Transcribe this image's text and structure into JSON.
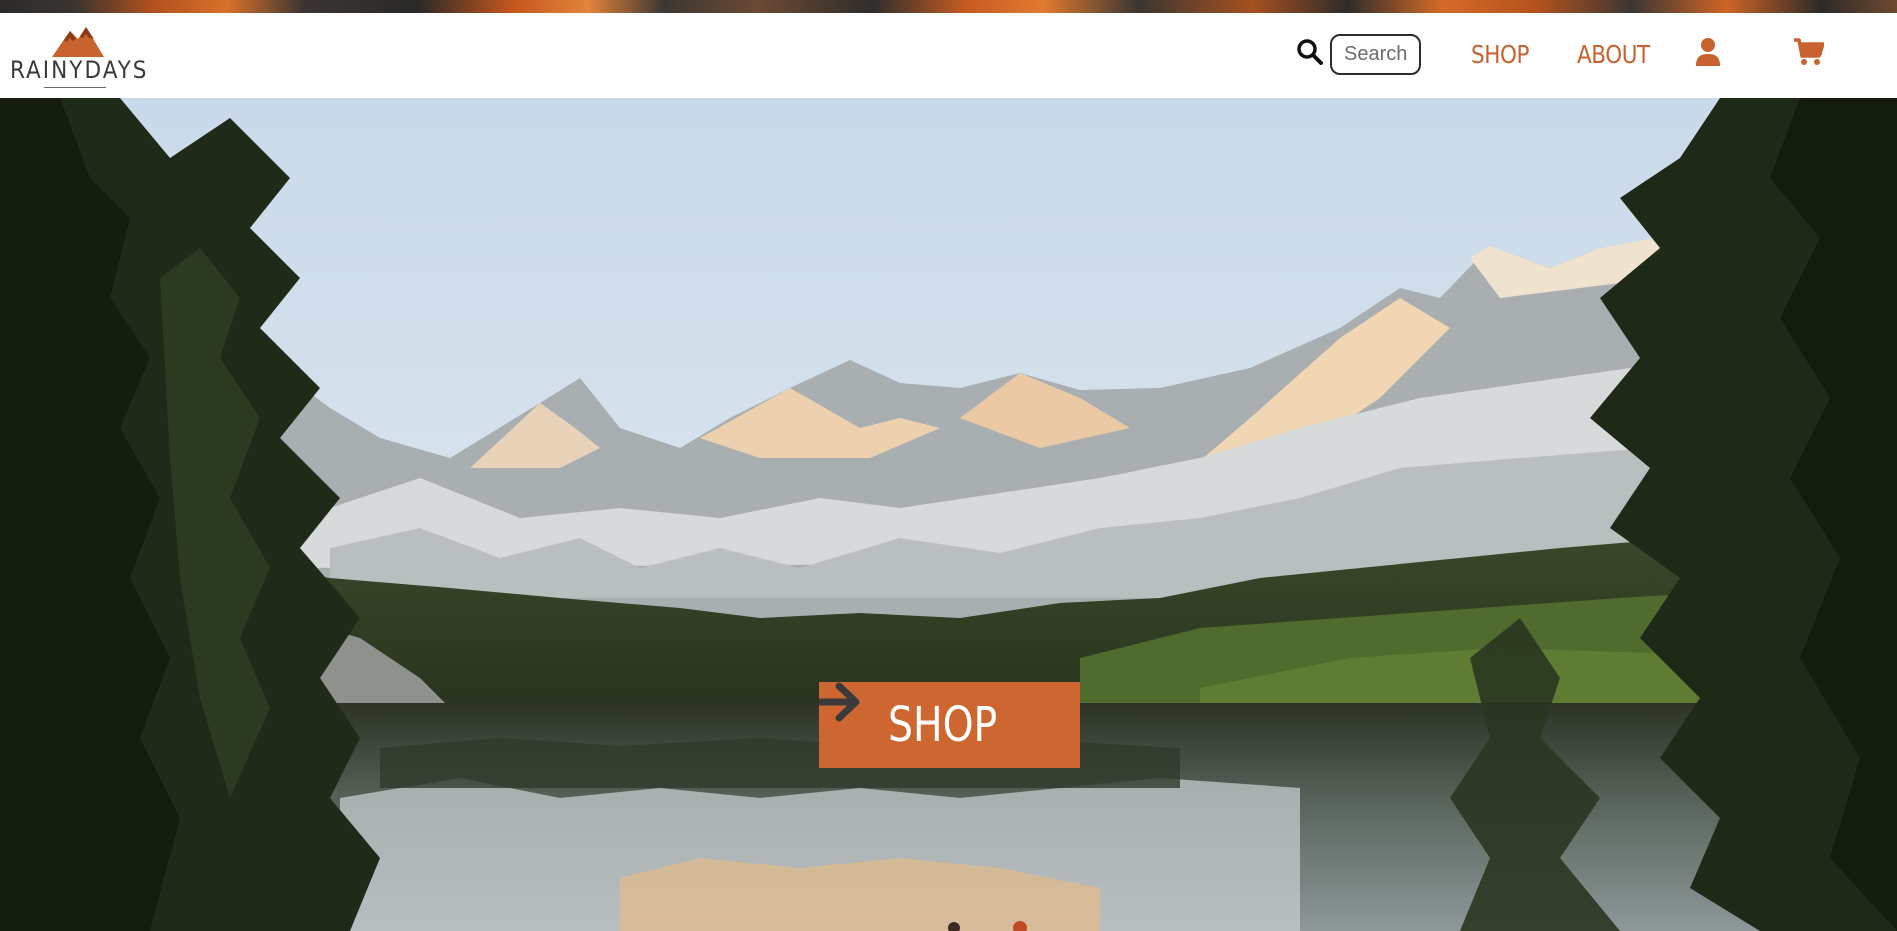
{
  "brand": {
    "name": "RAINYDAYS",
    "logo_icon": "mountain-logo-icon",
    "accent_color": "#cd6630",
    "nav_color": "#c8622f"
  },
  "header": {
    "search": {
      "icon": "search-icon",
      "placeholder": "Search",
      "value": ""
    },
    "nav": {
      "shop_label": "SHOP",
      "about_label": "ABOUT"
    },
    "icons": {
      "account": "user-icon",
      "cart": "cart-icon"
    }
  },
  "hero": {
    "background": "mountain-lake-photo",
    "cta_label": "SHOP",
    "cta_icon": "arrow-right-icon",
    "cta_color": "#cd6630"
  }
}
